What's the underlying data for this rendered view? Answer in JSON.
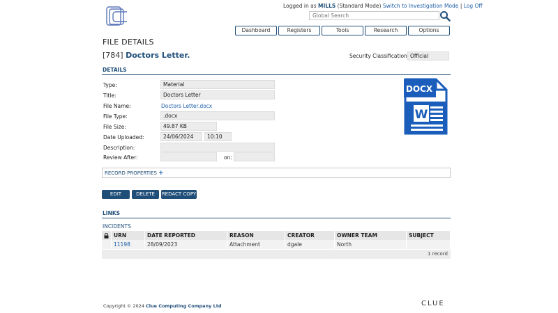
{
  "header": {
    "login_prefix": "Logged in as",
    "user": "MILLS",
    "mode": "(Standard Mode)",
    "switch_link": "Switch to Investigation Mode",
    "separator": "|",
    "logoff": "Log Off",
    "search_placeholder": "Global Search"
  },
  "nav": [
    "Dashboard",
    "Registers",
    "Tools",
    "Research",
    "Options"
  ],
  "page": {
    "title": "FILE DETAILS",
    "record_id": "[784]",
    "record_name": "Doctors Letter.",
    "security_label": "Security Classification:",
    "security_value": "Official"
  },
  "details": {
    "heading": "DETAILS",
    "type_label": "Type:",
    "type_value": "Material",
    "title_label": "Title:",
    "title_value": "Doctors Letter",
    "filename_label": "File Name:",
    "filename_value": "Doctors Letter.docx",
    "filetype_label": "File Type:",
    "filetype_value": ".docx",
    "filesize_label": "File Size:",
    "filesize_value": "49.87 KB",
    "uploaded_label": "Date Uploaded:",
    "uploaded_date": "24/06/2024",
    "uploaded_time": "10:10",
    "description_label": "Description:",
    "description_value": "",
    "review_label": "Review After:",
    "review_value": "",
    "on_label": "on:",
    "on_value": "",
    "icon_text": "DOCX",
    "icon_letter": "W"
  },
  "record_properties": "RECORD PROPERTIES",
  "buttons": {
    "edit": "EDIT",
    "delete": "DELETE",
    "redact": "REDACT COPY"
  },
  "links": {
    "heading": "LINKS",
    "incidents_heading": "INCIDENTS",
    "columns": [
      "URN",
      "DATE REPORTED",
      "REASON",
      "CREATOR",
      "OWNER TEAM",
      "SUBJECT"
    ],
    "rows": [
      {
        "urn": "11198",
        "date": "28/09/2023",
        "reason": "Attachment",
        "creator": "dgale",
        "team": "North",
        "subject": ""
      }
    ],
    "count": "1 record"
  },
  "footer": {
    "copyright": "Copyright © 2024",
    "company": "Clue Computing Company Ltd",
    "brand": "CLUE"
  },
  "colors": {
    "primary": "#1f4e79",
    "link": "#1f5fa8",
    "docx_blue": "#1a5dbb"
  }
}
